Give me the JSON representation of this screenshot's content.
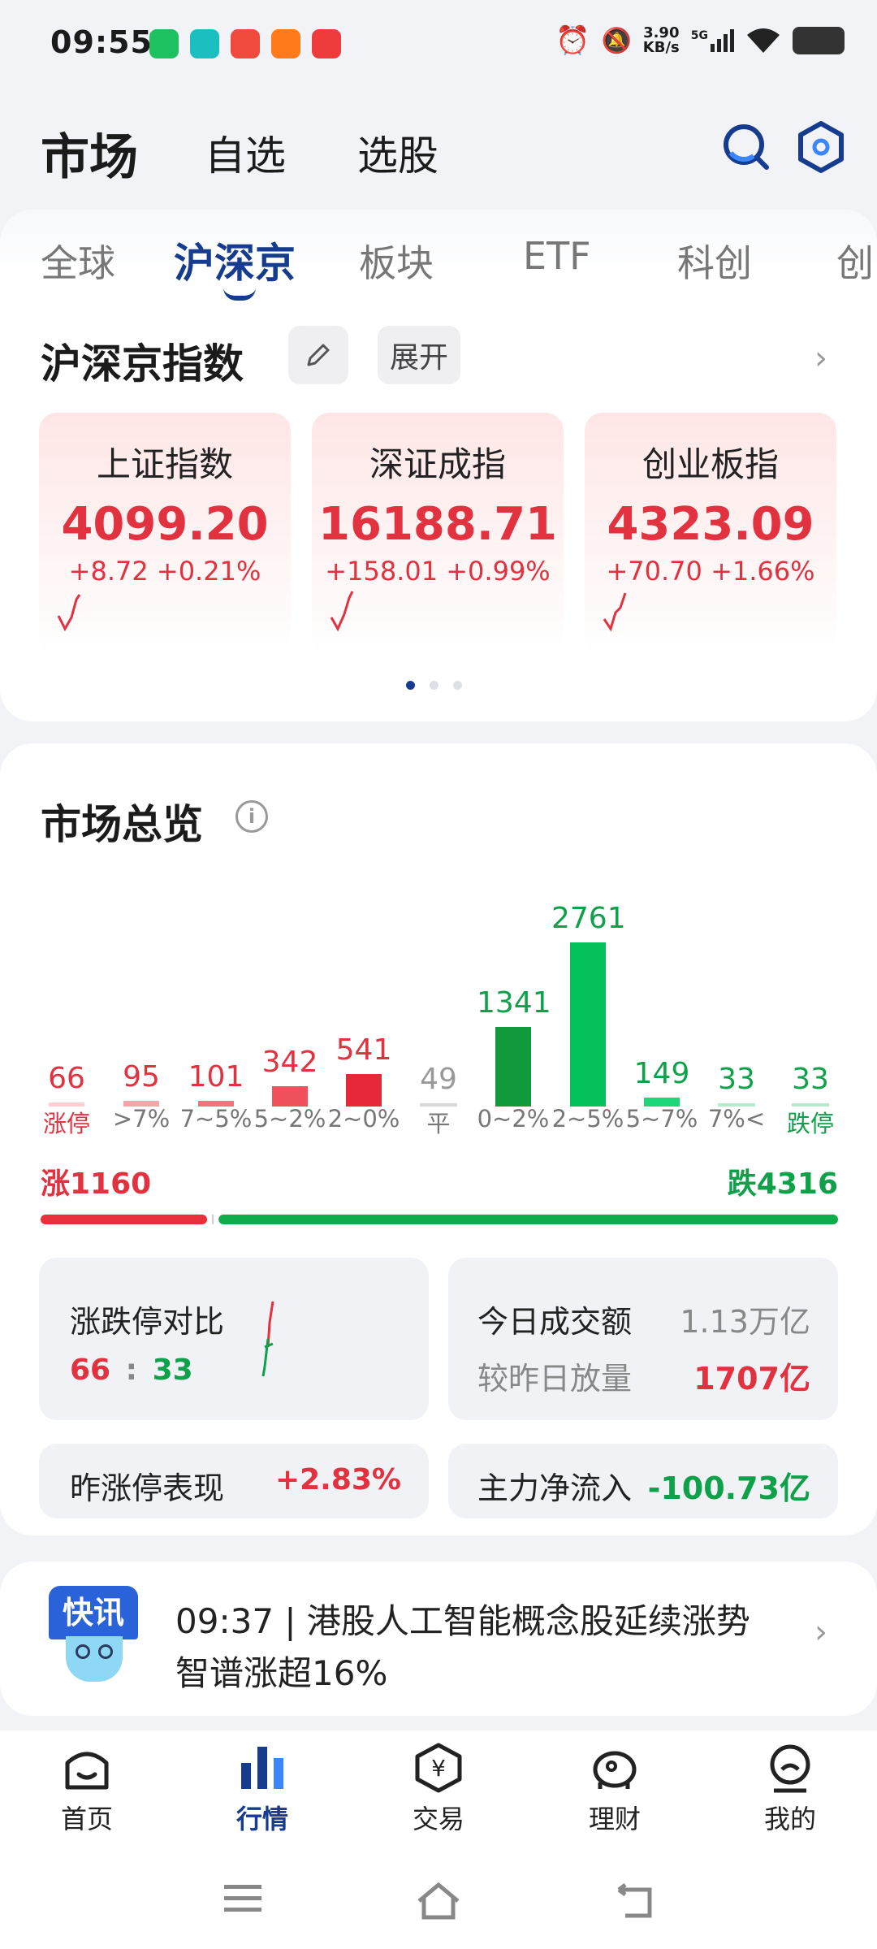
{
  "status_bar": {
    "time": "09:55",
    "net_speed": "3.90\nKB/s",
    "net_speed_top": "3.90",
    "net_speed_bottom": "KB/s",
    "signal": "5G"
  },
  "header": {
    "title": "市场",
    "tab_watchlist": "自选",
    "tab_screener": "选股"
  },
  "tabs": [
    "全球",
    "沪深京",
    "板块",
    "ETF",
    "科创",
    "创"
  ],
  "indices": {
    "title": "沪深京指数",
    "expand_label": "展开",
    "cards": [
      {
        "name": "上证指数",
        "value": "4099.20",
        "change": "+8.72",
        "pct": "+0.21%"
      },
      {
        "name": "深证成指",
        "value": "16188.71",
        "change": "+158.01",
        "pct": "+0.99%"
      },
      {
        "name": "创业板指",
        "value": "4323.09",
        "change": "+70.70",
        "pct": "+1.66%"
      }
    ]
  },
  "overview": {
    "title": "市场总览",
    "chart_data": {
      "type": "bar",
      "categories": [
        "涨停",
        ">7%",
        "7~5%",
        "5~2%",
        "2~0%",
        "平",
        "0~2%",
        "2~5%",
        "5~7%",
        "7%<",
        "跌停"
      ],
      "values": [
        66,
        95,
        101,
        342,
        541,
        49,
        1341,
        2761,
        149,
        33,
        33
      ]
    },
    "up_label": "涨1160",
    "down_label": "跌4316",
    "up_count": 1160,
    "down_count": 4316,
    "limit_compare": {
      "label": "涨跌停对比",
      "up": "66",
      "sep": ":",
      "down": "33"
    },
    "turnover": {
      "label": "今日成交额",
      "value": "1.13万亿",
      "vs_label": "较昨日放量",
      "vs_value": "1707亿"
    },
    "prev_limit": {
      "label": "昨涨停表现",
      "value": "+2.83%"
    },
    "main_flow": {
      "label": "主力净流入",
      "value": "-100.73亿"
    }
  },
  "news": {
    "badge": "快讯",
    "text_line1": "09:37 | 港股人工智能概念股延续涨势",
    "text_line2": "智谱涨超16%"
  },
  "bottom_nav": [
    "首页",
    "行情",
    "交易",
    "理财",
    "我的"
  ],
  "colors": {
    "accent": "#163c8f",
    "up": "#e2313f",
    "down": "#0ea14a"
  }
}
